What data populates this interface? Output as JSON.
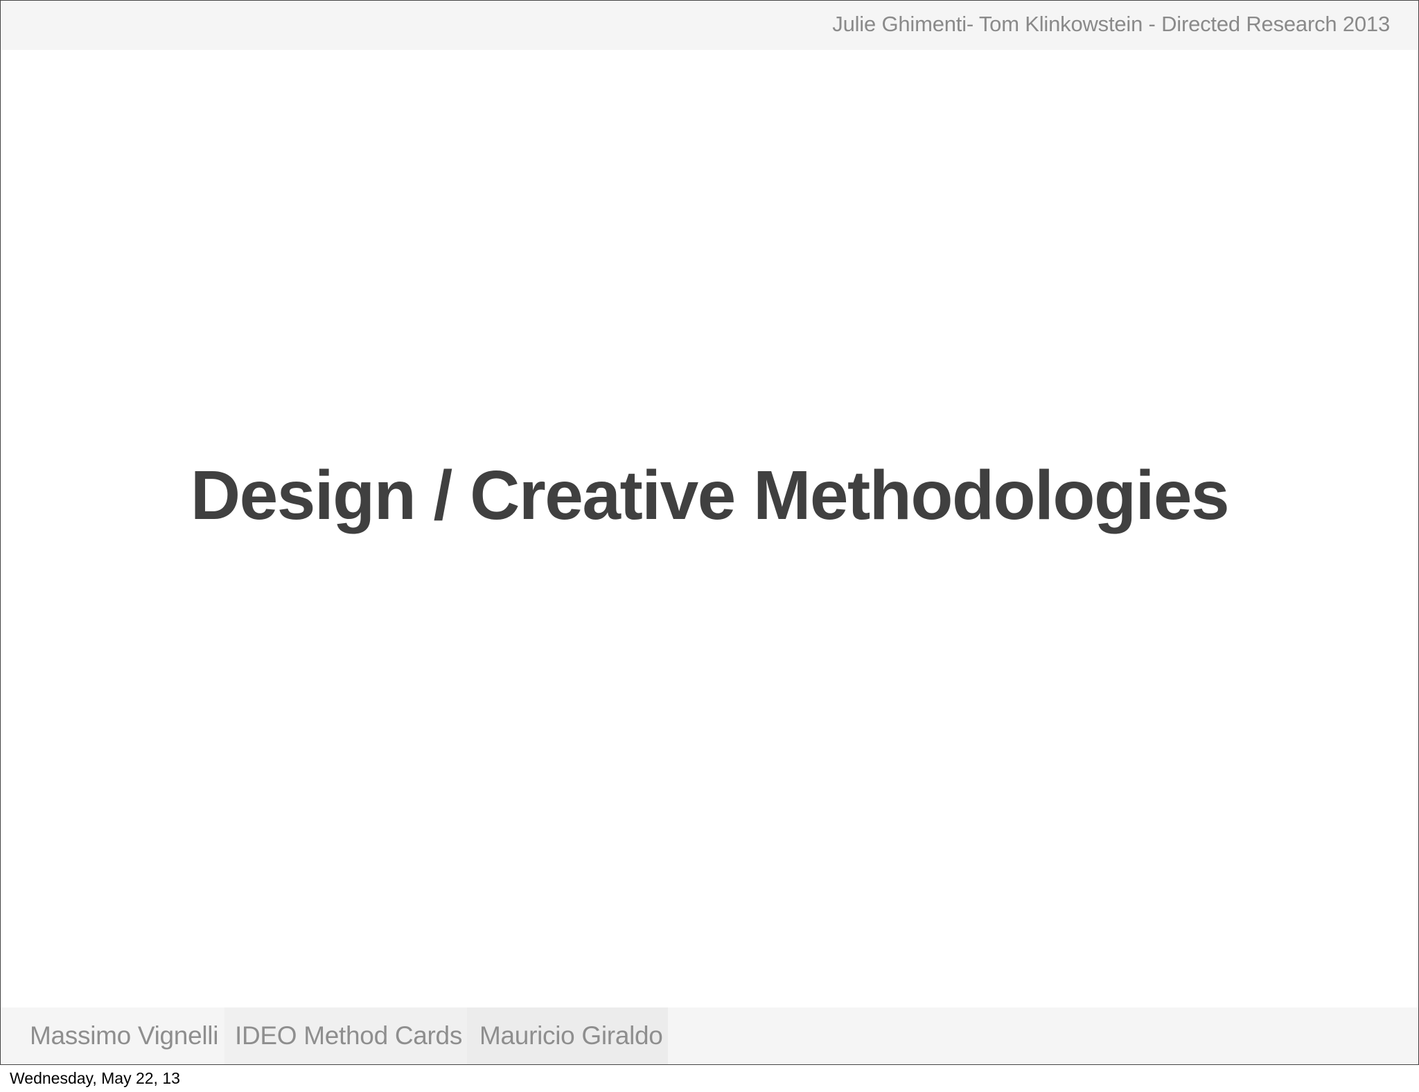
{
  "header": {
    "text": "Julie Ghimenti- Tom Klinkowstein - Directed Research 2013"
  },
  "slide": {
    "title": "Design / Creative Methodologies"
  },
  "footer_nav": {
    "items": [
      {
        "label": "Massimo Vignelli"
      },
      {
        "label": "IDEO Method Cards"
      },
      {
        "label": "Mauricio Giraldo"
      }
    ]
  },
  "print_footer": {
    "date": "Wednesday, May 22, 13"
  }
}
